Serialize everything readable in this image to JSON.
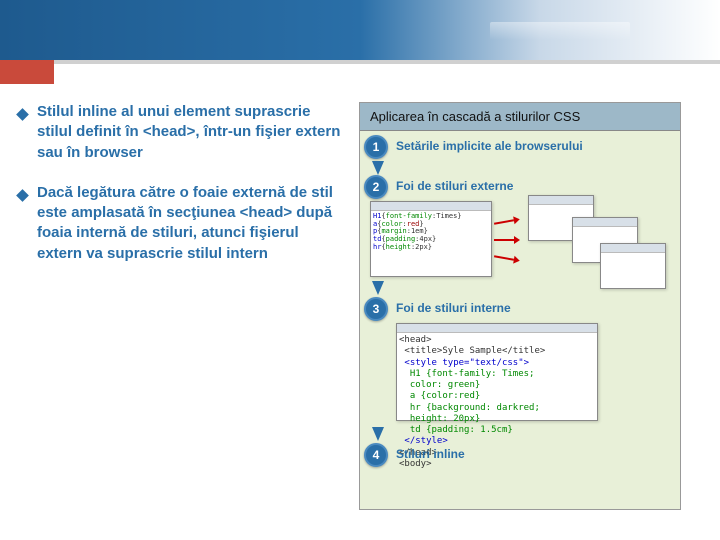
{
  "bullets": [
    "Stilul inline al unui element suprascrie stilul definit în <head>, într-un fişier extern sau în browser",
    "Dacă legătura către o foaie externă de stil este amplasată în secţiunea <head> după foaia internă de stiluri, atunci fişierul extern va suprascrie stilul intern"
  ],
  "diagram": {
    "title": "Aplicarea în cascadă a stilurilor CSS",
    "steps": [
      "1",
      "2",
      "3",
      "4"
    ],
    "labels": [
      "Setările implicite ale browserului",
      "Foi de stiluri externe",
      "Foi de stiluri interne",
      "Stiluri inline"
    ],
    "code3": "<head>\n <title>Syle Sample</title>\n <style type=\"text/css\">\n  H1 {font-family: Times;\n  color: green}\n  a {color:red}\n  hr {background: darkred;\n  height: 20px}\n  td {padding: 1.5cm}\n </style>\n</head>\n<body>"
  }
}
